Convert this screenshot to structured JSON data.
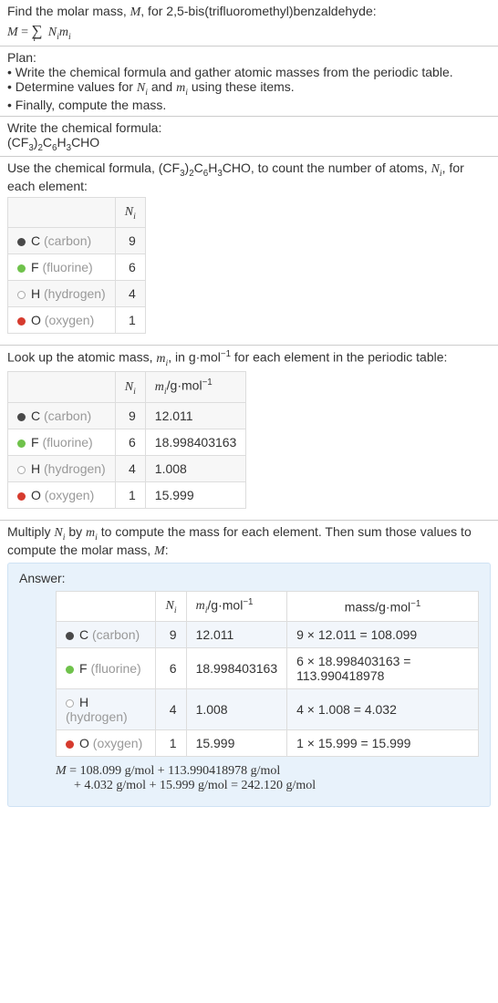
{
  "header": {
    "line1": "Find the molar mass, <span class='ital'>M</span>, for 2,5-bis(trifluoromethyl)benzaldehyde:",
    "eq": "<span class='ital'>M</span> = <span class='sum-sym'>∑</span><span style='position:relative; top:6px; left:-10px; font-size:0.7em; font-style:italic;'>i</span> <span class='ital'>N<sub>i</sub>m<sub>i</sub></span>"
  },
  "plan": {
    "title": "Plan:",
    "b1": "• Write the chemical formula and gather atomic masses from the periodic table.",
    "b2": "• Determine values for <span class='ital'>N<sub>i</sub></span> and <span class='ital'>m<sub>i</sub></span> using these items.",
    "b3": "• Finally, compute the mass."
  },
  "formula": {
    "title": "Write the chemical formula:",
    "text": "(CF<sub>3</sub>)<sub>2</sub>C<sub>6</sub>H<sub>3</sub>CHO"
  },
  "count_intro": "Use the chemical formula, (CF<sub>3</sub>)<sub>2</sub>C<sub>6</sub>H<sub>3</sub>CHO, to count the number of atoms, <span class='ital'>N<sub>i</sub></span>, for each element:",
  "ni_col": "<span class='ital'>N<sub>i</sub></span>",
  "mi_col": "<span class='ital'>m<sub>i</sub></span>/g·mol<sup>−1</sup>",
  "mass_col": "mass/g·mol<sup>−1</sup>",
  "elements": {
    "c": {
      "label": "C",
      "name": "(carbon)",
      "n": "9",
      "m": "12.011"
    },
    "f": {
      "label": "F",
      "name": "(fluorine)",
      "n": "6",
      "m": "18.998403163"
    },
    "h": {
      "label": "H",
      "name": "(hydrogen)",
      "n": "4",
      "m": "1.008"
    },
    "o": {
      "label": "O",
      "name": "(oxygen)",
      "n": "1",
      "m": "15.999"
    }
  },
  "lookup_intro": "Look up the atomic mass, <span class='ital'>m<sub>i</sub></span>, in g·mol<sup>−1</sup> for each element in the periodic table:",
  "multiply_intro": "Multiply <span class='ital'>N<sub>i</sub></span> by <span class='ital'>m<sub>i</sub></span> to compute the mass for each element. Then sum those values to compute the molar mass, <span class='ital'>M</span>:",
  "answer": {
    "label": "Answer:",
    "mass": {
      "c": "9 × 12.011 = 108.099",
      "f": "6 × 18.998403163 = 113.990418978",
      "h": "4 × 1.008 = 4.032",
      "o": "1 × 15.999 = 15.999"
    },
    "final_line1": "<span class='ital'>M</span> = 108.099 g/mol + 113.990418978 g/mol",
    "final_line2": "+ 4.032 g/mol + 15.999 g/mol = 242.120 g/mol"
  }
}
